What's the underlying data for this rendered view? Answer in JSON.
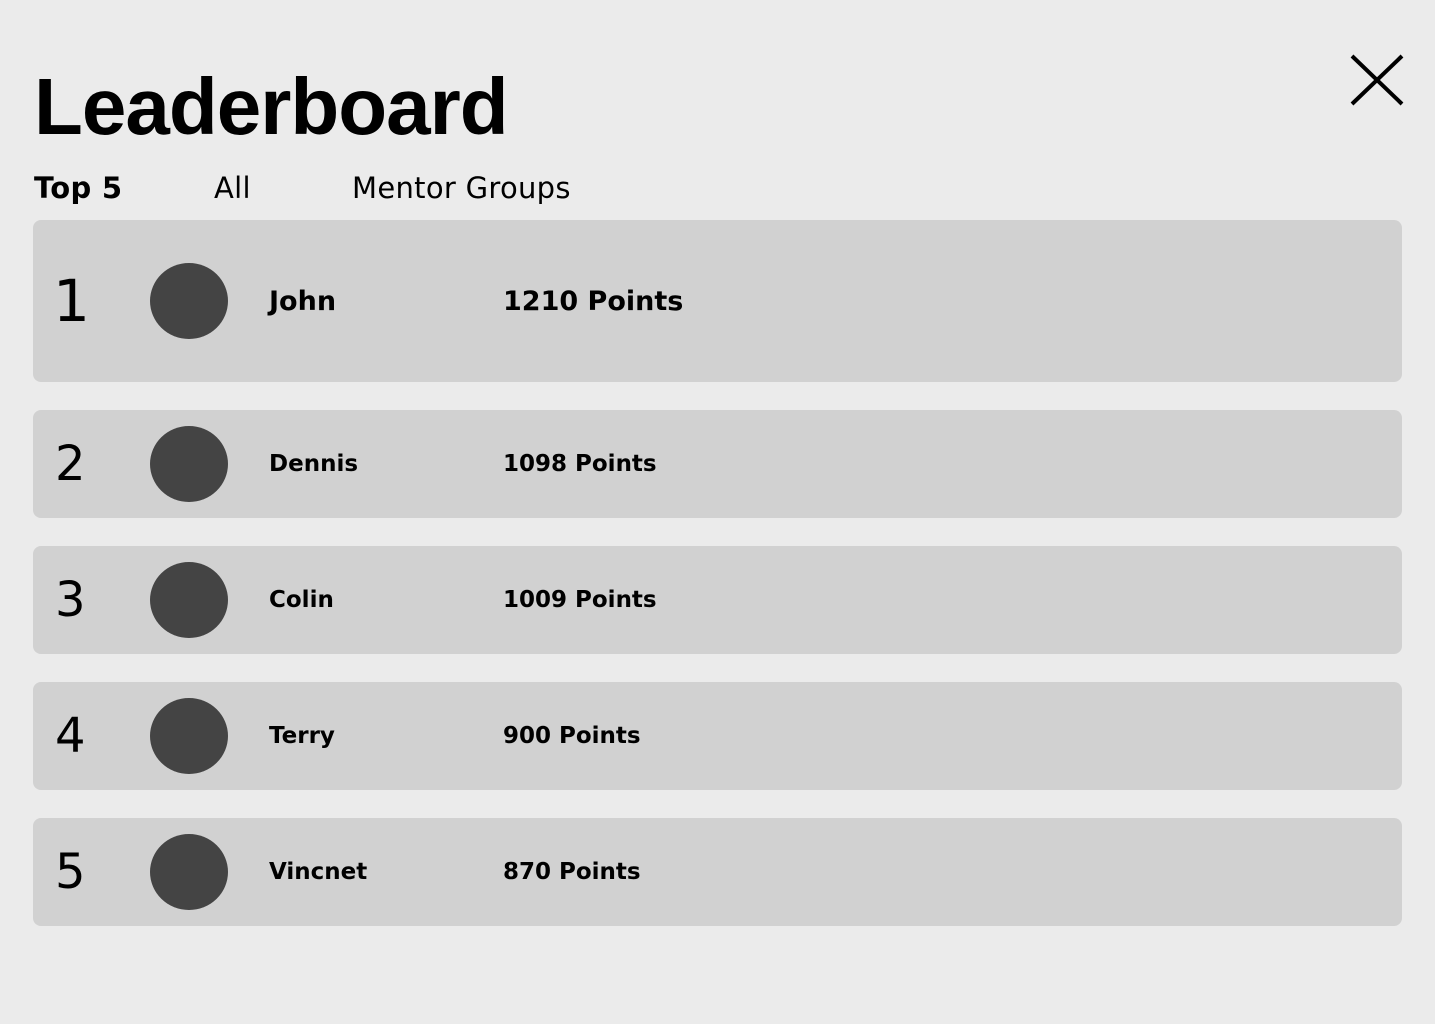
{
  "header": {
    "title": "Leaderboard",
    "close_icon": "close-icon"
  },
  "tabs": [
    {
      "label": "Top 5",
      "active": true
    },
    {
      "label": "All",
      "active": false
    },
    {
      "label": "Mentor Groups",
      "active": false
    }
  ],
  "leaderboard": {
    "rows": [
      {
        "rank": "1",
        "name": "John",
        "points": "1210 Points"
      },
      {
        "rank": "2",
        "name": "Dennis",
        "points": "1098 Points"
      },
      {
        "rank": "3",
        "name": "Colin",
        "points": "1009 Points"
      },
      {
        "rank": "4",
        "name": "Terry",
        "points": "900 Points"
      },
      {
        "rank": "5",
        "name": "Vincnet",
        "points": "870 Points"
      }
    ]
  },
  "colors": {
    "background": "#ebebeb",
    "row_background": "#d1d1d1",
    "avatar": "#444444",
    "text": "#000000"
  }
}
